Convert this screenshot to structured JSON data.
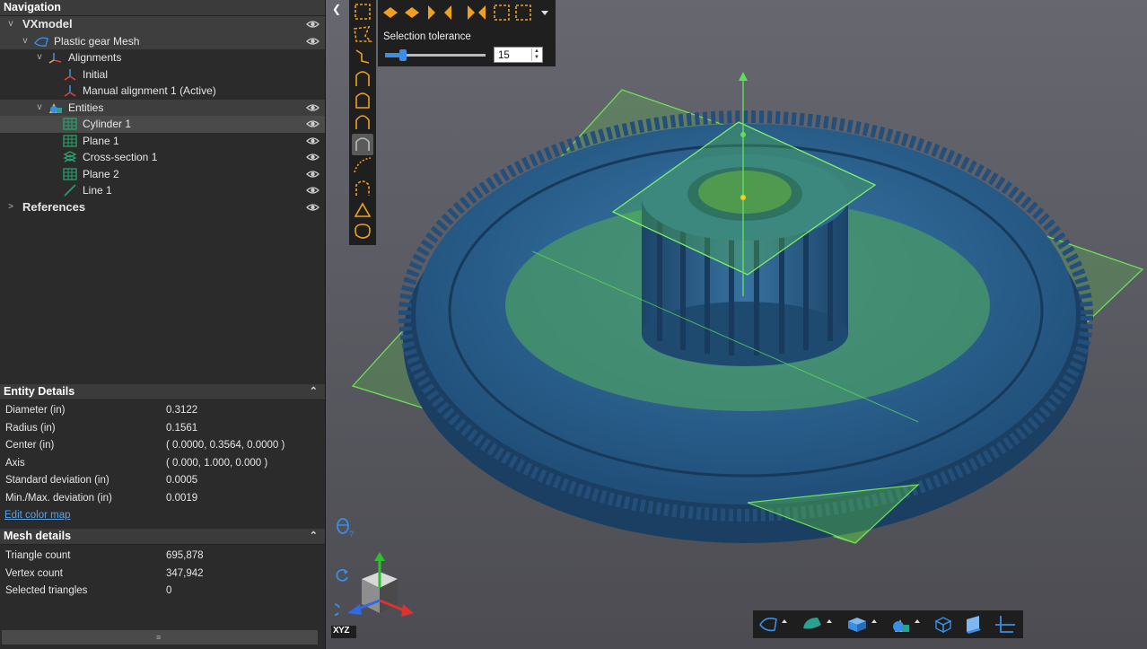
{
  "navigation": {
    "title": "Navigation",
    "tree": [
      {
        "label": "VXmodel",
        "level": 0,
        "expanded": true,
        "bold": true,
        "icon": "none",
        "visible": true
      },
      {
        "label": "Plastic gear Mesh",
        "level": 1,
        "expanded": true,
        "icon": "mesh-icon",
        "visible": true
      },
      {
        "label": "Alignments",
        "level": 2,
        "expanded": true,
        "icon": "alignments-icon",
        "visible": false
      },
      {
        "label": "Initial",
        "level": 3,
        "icon": "axes-icon",
        "visible": false
      },
      {
        "label": "Manual alignment 1 (Active)",
        "level": 3,
        "icon": "axes-icon",
        "visible": false
      },
      {
        "label": "Entities",
        "level": 2,
        "expanded": true,
        "icon": "entities-icon",
        "visible": true
      },
      {
        "label": "Cylinder 1",
        "level": 3,
        "icon": "cylinder-icon",
        "visible": true,
        "selected": true
      },
      {
        "label": "Plane 1",
        "level": 3,
        "icon": "plane-icon",
        "visible": true
      },
      {
        "label": "Cross-section 1",
        "level": 3,
        "icon": "cross-section-icon",
        "visible": true
      },
      {
        "label": "Plane 2",
        "level": 3,
        "icon": "plane-icon",
        "visible": true
      },
      {
        "label": "Line 1",
        "level": 3,
        "icon": "line-icon",
        "visible": true
      },
      {
        "label": "References",
        "level": 0,
        "expanded": false,
        "bold": true,
        "icon": "none",
        "visible": true
      }
    ]
  },
  "entity_details": {
    "title": "Entity Details",
    "rows": [
      {
        "key": "Diameter (in)",
        "value": "0.3122"
      },
      {
        "key": "Radius (in)",
        "value": "0.1561"
      },
      {
        "key": "Center (in)",
        "value": "( 0.0000, 0.3564, 0.0000 )"
      },
      {
        "key": "Axis",
        "value": "( 0.000, 1.000, 0.000 )"
      },
      {
        "key": "Standard deviation (in)",
        "value": "0.0005"
      },
      {
        "key": "Min./Max. deviation (in)",
        "value": "0.0019"
      }
    ],
    "link": "Edit color map"
  },
  "mesh_details": {
    "title": "Mesh details",
    "rows": [
      {
        "key": "Triangle count",
        "value": "695,878"
      },
      {
        "key": "Vertex count",
        "value": "347,942"
      },
      {
        "key": "Selected triangles",
        "value": "0"
      }
    ]
  },
  "selection": {
    "label": "Selection tolerance",
    "value": "15",
    "slider_fraction": 0.18
  },
  "colors": {
    "accent": "#f0a020",
    "mesh": "#2a5f8f",
    "plane": "#59c64a",
    "panel": "#2b2b2b",
    "link": "#5aa2e8"
  },
  "axis_label": "XYZ"
}
